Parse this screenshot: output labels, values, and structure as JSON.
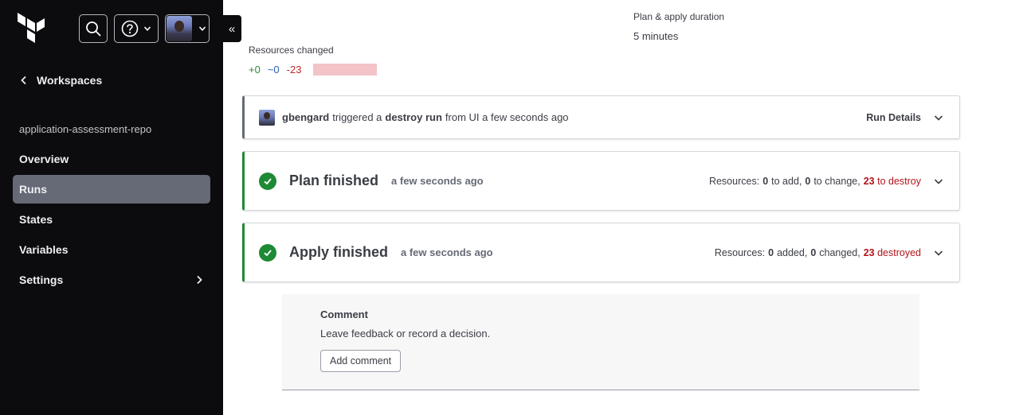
{
  "sidebar": {
    "logo": "terraform-logo",
    "back_label": "Workspaces",
    "workspace_name": "application-assessment-repo",
    "nav_items": [
      {
        "label": "Overview",
        "active": false
      },
      {
        "label": "Runs",
        "active": true
      },
      {
        "label": "States",
        "active": false
      },
      {
        "label": "Variables",
        "active": false
      },
      {
        "label": "Settings",
        "active": false
      }
    ]
  },
  "summary": {
    "resources_changed_label": "Resources changed",
    "added": "+0",
    "changed": "~0",
    "destroyed": "-23",
    "duration_label": "Plan & apply duration",
    "duration_value": "5 minutes"
  },
  "trigger": {
    "user": "gbengard",
    "text1": "triggered a",
    "run_type": "destroy run",
    "text2": "from UI a few seconds ago",
    "details_label": "Run Details"
  },
  "plan": {
    "title": "Plan finished",
    "time": "a few seconds ago",
    "resources_label": "Resources:",
    "add_count": "0",
    "add_label": "to add,",
    "change_count": "0",
    "change_label": "to change,",
    "destroy_count": "23",
    "destroy_label": "to destroy"
  },
  "apply": {
    "title": "Apply finished",
    "time": "a few seconds ago",
    "resources_label": "Resources:",
    "add_count": "0",
    "add_label": "added,",
    "change_count": "0",
    "change_label": "changed,",
    "destroy_count": "23",
    "destroy_label": "destroyed"
  },
  "comment": {
    "title": "Comment",
    "description": "Leave feedback or record a decision.",
    "button_label": "Add comment"
  },
  "colors": {
    "sidebar_bg": "#0c0c0e",
    "active_nav": "#656a76",
    "success": "#1e8a35",
    "destroy": "#b3141c"
  }
}
